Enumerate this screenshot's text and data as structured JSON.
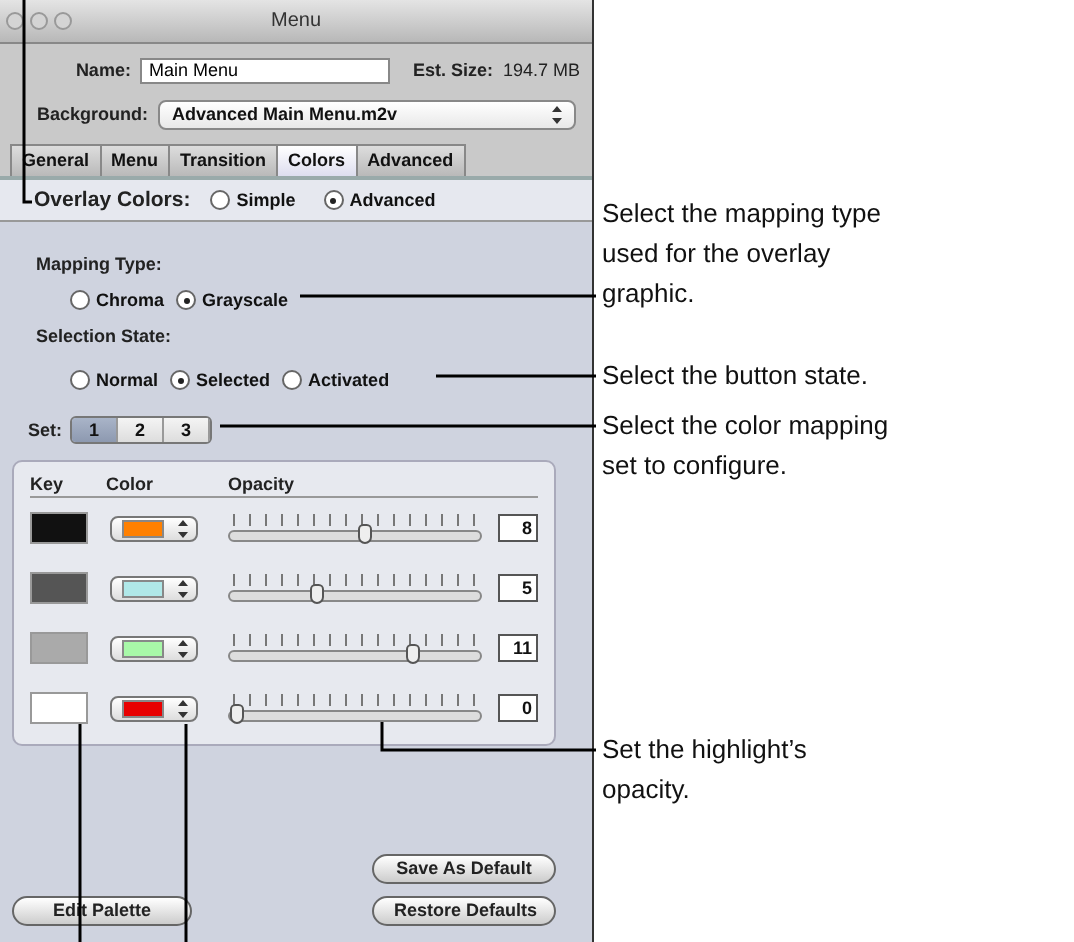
{
  "window": {
    "title": "Menu",
    "name_label": "Name:",
    "name_value": "Main Menu",
    "est_size_label": "Est. Size:",
    "est_size_value": "194.7 MB",
    "background_label": "Background:",
    "background_value": "Advanced Main Menu.m2v"
  },
  "tabs": [
    {
      "label": "General",
      "selected": false
    },
    {
      "label": "Menu",
      "selected": false
    },
    {
      "label": "Transition",
      "selected": false
    },
    {
      "label": "Colors",
      "selected": true
    },
    {
      "label": "Advanced",
      "selected": false
    }
  ],
  "overlay_colors": {
    "label": "Overlay Colors:",
    "options": [
      {
        "label": "Simple",
        "selected": false
      },
      {
        "label": "Advanced",
        "selected": true
      }
    ]
  },
  "mapping_type": {
    "label": "Mapping Type:",
    "options": [
      {
        "label": "Chroma",
        "selected": false
      },
      {
        "label": "Grayscale",
        "selected": true
      }
    ]
  },
  "selection_state": {
    "label": "Selection State:",
    "options": [
      {
        "label": "Normal",
        "selected": false
      },
      {
        "label": "Selected",
        "selected": true
      },
      {
        "label": "Activated",
        "selected": false
      }
    ]
  },
  "set": {
    "label": "Set:",
    "options": [
      {
        "label": "1",
        "selected": true
      },
      {
        "label": "2",
        "selected": false
      },
      {
        "label": "3",
        "selected": false
      }
    ]
  },
  "table": {
    "columns": [
      "Key",
      "Color",
      "Opacity"
    ],
    "rows": [
      {
        "key": {
          "color": "#111111"
        },
        "color": "#ff8000",
        "level": 0.533,
        "reading": "8"
      },
      {
        "key": {
          "color": "#555555"
        },
        "color": "#b0e8e8",
        "level": 0.333,
        "reading": "5"
      },
      {
        "key": {
          "color": "#aaaaaa"
        },
        "color": "#a8f8a8",
        "level": 0.733,
        "reading": "11"
      },
      {
        "key": {
          "color": "#ffffff"
        },
        "color": "#e80000",
        "level": 0,
        "reading": "0"
      }
    ]
  },
  "buttons": [
    {
      "kind": "save",
      "label": "Save As Default"
    },
    {
      "kind": "edit",
      "label": "Edit Palette"
    },
    {
      "kind": "restore",
      "label": "Restore Defaults"
    }
  ],
  "callouts": [
    {
      "lines": [
        "Select the mapping type",
        "used for the overlay",
        "graphic."
      ]
    },
    {
      "lines": [
        "Select the button state."
      ]
    },
    {
      "lines": [
        "Select the color mapping",
        "set to configure."
      ]
    },
    {
      "lines": [
        "Set the highlight’s",
        "opacity."
      ]
    }
  ]
}
